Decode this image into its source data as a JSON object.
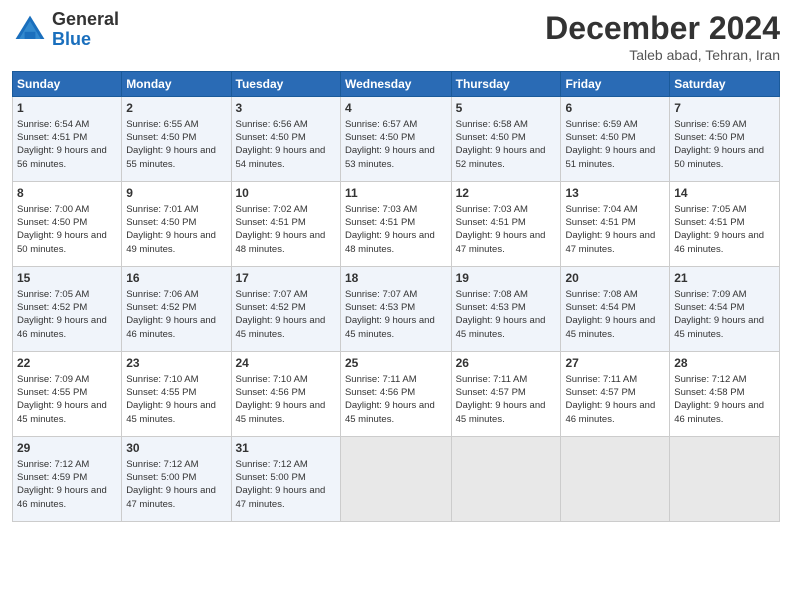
{
  "logo": {
    "line1": "General",
    "line2": "Blue"
  },
  "title": "December 2024",
  "subtitle": "Taleb abad, Tehran, Iran",
  "days_of_week": [
    "Sunday",
    "Monday",
    "Tuesday",
    "Wednesday",
    "Thursday",
    "Friday",
    "Saturday"
  ],
  "weeks": [
    [
      {
        "day": "1",
        "sunrise": "Sunrise: 6:54 AM",
        "sunset": "Sunset: 4:51 PM",
        "daylight": "Daylight: 9 hours and 56 minutes."
      },
      {
        "day": "2",
        "sunrise": "Sunrise: 6:55 AM",
        "sunset": "Sunset: 4:50 PM",
        "daylight": "Daylight: 9 hours and 55 minutes."
      },
      {
        "day": "3",
        "sunrise": "Sunrise: 6:56 AM",
        "sunset": "Sunset: 4:50 PM",
        "daylight": "Daylight: 9 hours and 54 minutes."
      },
      {
        "day": "4",
        "sunrise": "Sunrise: 6:57 AM",
        "sunset": "Sunset: 4:50 PM",
        "daylight": "Daylight: 9 hours and 53 minutes."
      },
      {
        "day": "5",
        "sunrise": "Sunrise: 6:58 AM",
        "sunset": "Sunset: 4:50 PM",
        "daylight": "Daylight: 9 hours and 52 minutes."
      },
      {
        "day": "6",
        "sunrise": "Sunrise: 6:59 AM",
        "sunset": "Sunset: 4:50 PM",
        "daylight": "Daylight: 9 hours and 51 minutes."
      },
      {
        "day": "7",
        "sunrise": "Sunrise: 6:59 AM",
        "sunset": "Sunset: 4:50 PM",
        "daylight": "Daylight: 9 hours and 50 minutes."
      }
    ],
    [
      {
        "day": "8",
        "sunrise": "Sunrise: 7:00 AM",
        "sunset": "Sunset: 4:50 PM",
        "daylight": "Daylight: 9 hours and 50 minutes."
      },
      {
        "day": "9",
        "sunrise": "Sunrise: 7:01 AM",
        "sunset": "Sunset: 4:50 PM",
        "daylight": "Daylight: 9 hours and 49 minutes."
      },
      {
        "day": "10",
        "sunrise": "Sunrise: 7:02 AM",
        "sunset": "Sunset: 4:51 PM",
        "daylight": "Daylight: 9 hours and 48 minutes."
      },
      {
        "day": "11",
        "sunrise": "Sunrise: 7:03 AM",
        "sunset": "Sunset: 4:51 PM",
        "daylight": "Daylight: 9 hours and 48 minutes."
      },
      {
        "day": "12",
        "sunrise": "Sunrise: 7:03 AM",
        "sunset": "Sunset: 4:51 PM",
        "daylight": "Daylight: 9 hours and 47 minutes."
      },
      {
        "day": "13",
        "sunrise": "Sunrise: 7:04 AM",
        "sunset": "Sunset: 4:51 PM",
        "daylight": "Daylight: 9 hours and 47 minutes."
      },
      {
        "day": "14",
        "sunrise": "Sunrise: 7:05 AM",
        "sunset": "Sunset: 4:51 PM",
        "daylight": "Daylight: 9 hours and 46 minutes."
      }
    ],
    [
      {
        "day": "15",
        "sunrise": "Sunrise: 7:05 AM",
        "sunset": "Sunset: 4:52 PM",
        "daylight": "Daylight: 9 hours and 46 minutes."
      },
      {
        "day": "16",
        "sunrise": "Sunrise: 7:06 AM",
        "sunset": "Sunset: 4:52 PM",
        "daylight": "Daylight: 9 hours and 46 minutes."
      },
      {
        "day": "17",
        "sunrise": "Sunrise: 7:07 AM",
        "sunset": "Sunset: 4:52 PM",
        "daylight": "Daylight: 9 hours and 45 minutes."
      },
      {
        "day": "18",
        "sunrise": "Sunrise: 7:07 AM",
        "sunset": "Sunset: 4:53 PM",
        "daylight": "Daylight: 9 hours and 45 minutes."
      },
      {
        "day": "19",
        "sunrise": "Sunrise: 7:08 AM",
        "sunset": "Sunset: 4:53 PM",
        "daylight": "Daylight: 9 hours and 45 minutes."
      },
      {
        "day": "20",
        "sunrise": "Sunrise: 7:08 AM",
        "sunset": "Sunset: 4:54 PM",
        "daylight": "Daylight: 9 hours and 45 minutes."
      },
      {
        "day": "21",
        "sunrise": "Sunrise: 7:09 AM",
        "sunset": "Sunset: 4:54 PM",
        "daylight": "Daylight: 9 hours and 45 minutes."
      }
    ],
    [
      {
        "day": "22",
        "sunrise": "Sunrise: 7:09 AM",
        "sunset": "Sunset: 4:55 PM",
        "daylight": "Daylight: 9 hours and 45 minutes."
      },
      {
        "day": "23",
        "sunrise": "Sunrise: 7:10 AM",
        "sunset": "Sunset: 4:55 PM",
        "daylight": "Daylight: 9 hours and 45 minutes."
      },
      {
        "day": "24",
        "sunrise": "Sunrise: 7:10 AM",
        "sunset": "Sunset: 4:56 PM",
        "daylight": "Daylight: 9 hours and 45 minutes."
      },
      {
        "day": "25",
        "sunrise": "Sunrise: 7:11 AM",
        "sunset": "Sunset: 4:56 PM",
        "daylight": "Daylight: 9 hours and 45 minutes."
      },
      {
        "day": "26",
        "sunrise": "Sunrise: 7:11 AM",
        "sunset": "Sunset: 4:57 PM",
        "daylight": "Daylight: 9 hours and 45 minutes."
      },
      {
        "day": "27",
        "sunrise": "Sunrise: 7:11 AM",
        "sunset": "Sunset: 4:57 PM",
        "daylight": "Daylight: 9 hours and 46 minutes."
      },
      {
        "day": "28",
        "sunrise": "Sunrise: 7:12 AM",
        "sunset": "Sunset: 4:58 PM",
        "daylight": "Daylight: 9 hours and 46 minutes."
      }
    ],
    [
      {
        "day": "29",
        "sunrise": "Sunrise: 7:12 AM",
        "sunset": "Sunset: 4:59 PM",
        "daylight": "Daylight: 9 hours and 46 minutes."
      },
      {
        "day": "30",
        "sunrise": "Sunrise: 7:12 AM",
        "sunset": "Sunset: 5:00 PM",
        "daylight": "Daylight: 9 hours and 47 minutes."
      },
      {
        "day": "31",
        "sunrise": "Sunrise: 7:12 AM",
        "sunset": "Sunset: 5:00 PM",
        "daylight": "Daylight: 9 hours and 47 minutes."
      },
      null,
      null,
      null,
      null
    ]
  ]
}
